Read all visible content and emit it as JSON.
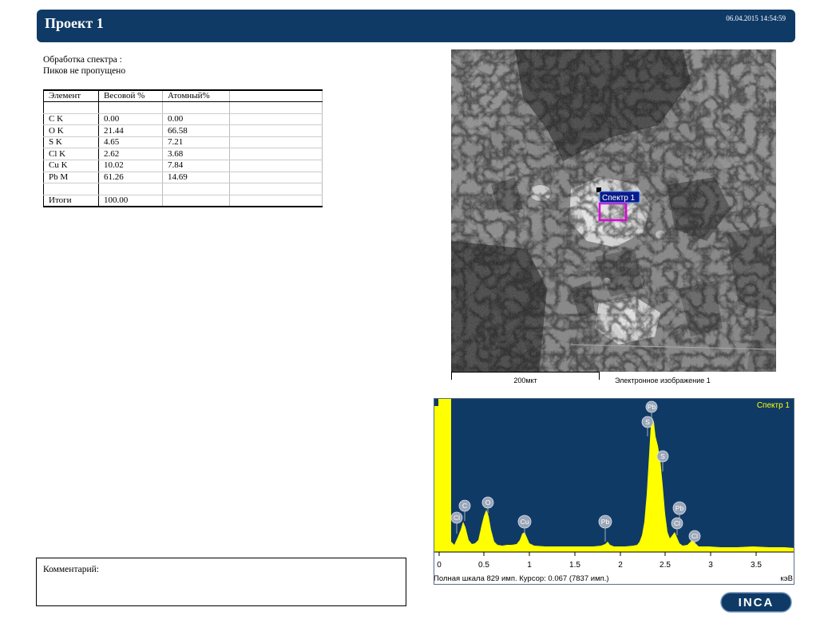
{
  "header": {
    "title": "Проект 1",
    "timestamp": "06.04.2015 14:54:59"
  },
  "processing": {
    "line1": "Обработка спектра :",
    "line2": "Пиков не пропущено"
  },
  "results_table": {
    "headers": [
      "Элемент",
      "Весовой %",
      "Атомный%",
      ""
    ],
    "rows": [
      [
        "",
        "",
        "",
        ""
      ],
      [
        "C K",
        "0.00",
        "0.00",
        ""
      ],
      [
        "O K",
        "21.44",
        "66.58",
        ""
      ],
      [
        "S K",
        "4.65",
        "7.21",
        ""
      ],
      [
        "Cl K",
        "2.62",
        "3.68",
        ""
      ],
      [
        "Cu K",
        "10.02",
        "7.84",
        ""
      ],
      [
        "Pb M",
        "61.26",
        "14.69",
        ""
      ],
      [
        "",
        "",
        "",
        ""
      ],
      [
        "Итоги",
        "100.00",
        "",
        ""
      ]
    ]
  },
  "sem_image": {
    "spectrum_marker_label": "Спектр 1",
    "scale_label": "200мкт",
    "caption": "Электронное изображение 1"
  },
  "spectrum": {
    "title": "Спектр 1",
    "x_ticks": [
      "0",
      "0.5",
      "1",
      "1.5",
      "2",
      "2.5",
      "3",
      "3.5"
    ],
    "unit": "кэВ",
    "status": "Полная шкала 829 имп. Курсор: 0.067  (7837 имп.)",
    "peak_labels": [
      "Pb",
      "S",
      "S",
      "C",
      "O",
      "Cl",
      "Cu",
      "Pb",
      "Pb",
      "Cl",
      "Cl"
    ],
    "colors": {
      "background": "#0f3a66",
      "fill": "#ffff00",
      "title": "#ffff00"
    }
  },
  "comment": {
    "label": "Комментарий:"
  },
  "logo": {
    "text": "INCA"
  }
}
